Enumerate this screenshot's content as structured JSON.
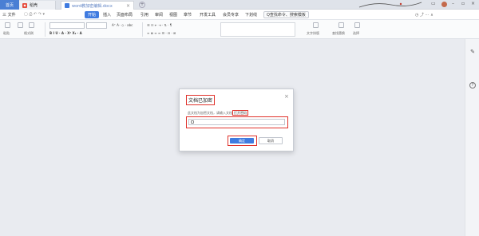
{
  "tabs": {
    "home": "首页",
    "draft": "稻壳",
    "doc": "word教加密编辑.docx"
  },
  "menu": {
    "file": "三 文件",
    "items": [
      "开始",
      "插入",
      "页面布局",
      "引用",
      "审阅",
      "视图",
      "章节",
      "开发工具",
      "会员专享",
      "下划线"
    ],
    "active_index": 0,
    "search": "Q查找命令、搜索模板"
  },
  "toolbar": {
    "format_painter": "格式刷",
    "paste": "粘贴",
    "style_label": "文字排版",
    "find_replace": "查找替换",
    "select": "选择"
  },
  "dialog": {
    "title": "文档已加密",
    "close": "×",
    "message_prefix": "此文档为加密文档，请输入文档",
    "message_highlight": "打开密码",
    "password_placeholder": "",
    "ok": "确定",
    "cancel": "取消"
  },
  "side": {
    "help": "?"
  },
  "colors": {
    "accent": "#3f7be0",
    "highlight": "#e0322b"
  }
}
